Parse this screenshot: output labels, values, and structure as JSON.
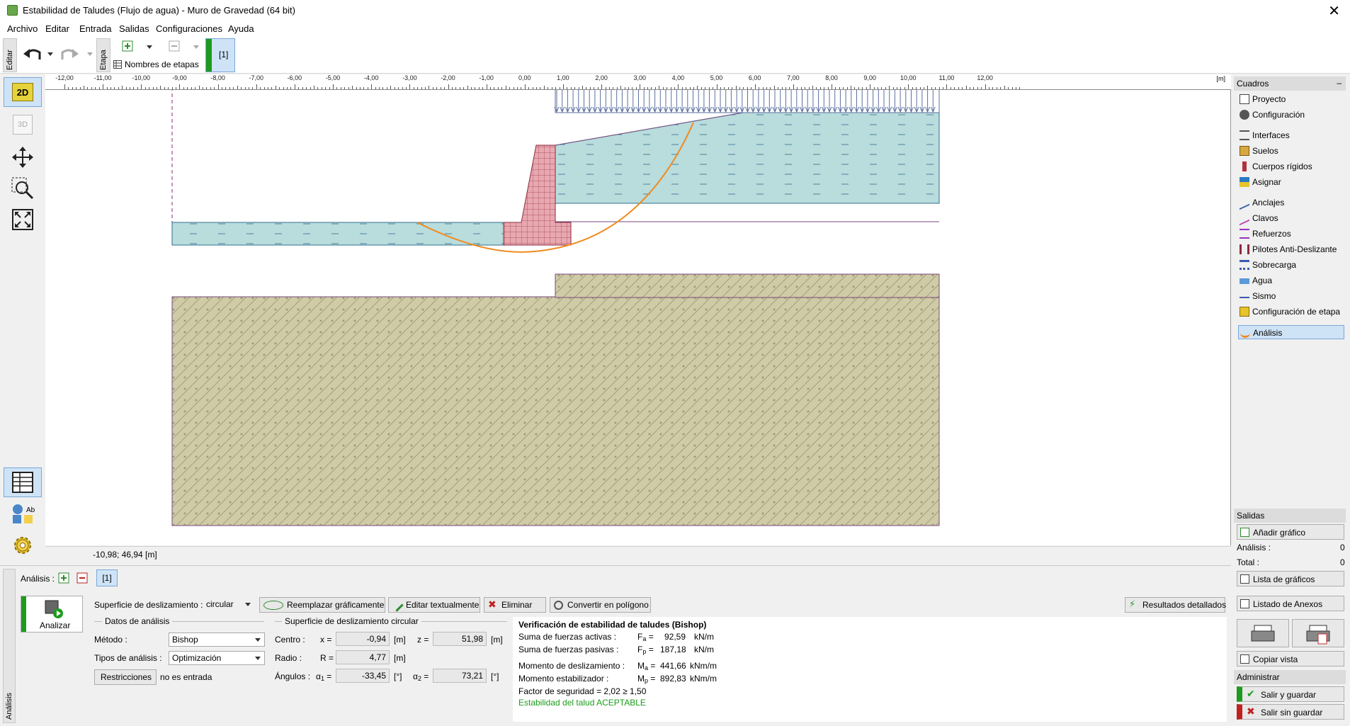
{
  "window": {
    "title": "Estabilidad de Taludes (Flujo de agua) - Muro de Gravedad (64 bit)",
    "close": "✕"
  },
  "menu": [
    "Archivo",
    "Editar",
    "Entrada",
    "Salidas",
    "Configuraciones",
    "Ayuda"
  ],
  "toolbar": {
    "edit_tab": "Editar",
    "stage_tab": "Etapa",
    "stage_names_label": "Nombres de etapas",
    "stage_button": "[1]"
  },
  "ruler": {
    "unit": "[m]",
    "ticks": [
      "-12,00",
      "-11,00",
      "-10,00",
      "-9,00",
      "-8,00",
      "-7,00",
      "-6,00",
      "-5,00",
      "-4,00",
      "-3,00",
      "-2,00",
      "-1,00",
      "0,00",
      "1,00",
      "2,00",
      "3,00",
      "4,00",
      "5,00",
      "6,00",
      "7,00",
      "8,00",
      "9,00",
      "10,00",
      "11,00",
      "12,00"
    ]
  },
  "leftpanel": {
    "view2d": "2D",
    "view3d": "3D",
    "ab_label": "Ab"
  },
  "status": {
    "coordinates": "-10,98; 46,94 [m]"
  },
  "right_panel": {
    "cuadros_title": "Cuadros",
    "collapse": "–",
    "items": [
      "Proyecto",
      "Configuración",
      "Interfaces",
      "Suelos",
      "Cuerpos rígidos",
      "Asignar",
      "Anclajes",
      "Clavos",
      "Refuerzos",
      "Pilotes Anti-Deslizante",
      "Sobrecarga",
      "Agua",
      "Sismo",
      "Configuración de etapa",
      "Análisis"
    ],
    "salidas_title": "Salidas",
    "add_chart": "Añadir gráfico",
    "analysis_label": "Análisis :",
    "analysis_count": "0",
    "total_label": "Total :",
    "total_count": "0",
    "chart_list": "Lista de gráficos",
    "annex_list": "Listado de Anexos",
    "copy_view": "Copiar vista",
    "admin_title": "Administrar",
    "save_exit": "Salir y guardar",
    "exit_nosave": "Salir sin guardar"
  },
  "bottom": {
    "side_tab": "Análisis",
    "analysis_label": "Análisis :",
    "analysis_button": "[1]",
    "analyze_label": "Analizar",
    "slip_surface_label": "Superficie de deslizamiento :",
    "slip_surface_value": "circular",
    "replace_graphic": "Reemplazar gráficamente",
    "edit_text": "Editar textualmente",
    "delete": "Eliminar",
    "convert_polygon": "Convertir en polígono",
    "detailed_results": "Resultados detallados",
    "analysis_data_title": "Datos de análisis",
    "method_label": "Método :",
    "method_value": "Bishop",
    "analysis_type_label": "Tipos de análisis :",
    "analysis_type_value": "Optimización",
    "restrictions_button": "Restricciones",
    "restrictions_value": "no es entrada",
    "circle_title": "Superficie de deslizamiento circular",
    "center_label": "Centro :",
    "x_label": "x =",
    "x_value": "-0,94",
    "x_unit": "[m]",
    "z_label": "z =",
    "z_value": "51,98",
    "z_unit": "[m]",
    "radius_label": "Radio :",
    "r_label": "R =",
    "r_value": "4,77",
    "r_unit": "[m]",
    "angles_label": "Ángulos :",
    "a1_label": "α",
    "a1_sub": "1",
    "a1_eq": "=",
    "a1_value": "-33,45",
    "a1_unit": "[°]",
    "a2_label": "α",
    "a2_sub": "2",
    "a2_eq": "=",
    "a2_value": "73,21",
    "a2_unit": "[°]"
  },
  "results": {
    "title": "Verificación de estabilidad de taludes (Bishop)",
    "active_label": "Suma de fuerzas activas :",
    "active_symbol": "F",
    "active_sub": "a",
    "active_value": "92,59",
    "active_unit": "kN/m",
    "passive_label": "Suma de fuerzas pasivas :",
    "passive_symbol": "F",
    "passive_sub": "p",
    "passive_value": "187,18",
    "passive_unit": "kN/m",
    "slide_moment_label": "Momento de deslizamiento :",
    "slide_symbol": "M",
    "slide_sub": "a",
    "slide_value": "441,66",
    "slide_unit": "kNm/m",
    "stab_moment_label": "Momento estabilizador :",
    "stab_symbol": "M",
    "stab_sub": "p",
    "stab_value": "892,83",
    "stab_unit": "kNm/m",
    "fs_line": "Factor de seguridad = 2,02 ≥ 1,50",
    "verdict": "Estabilidad del talud ACEPTABLE",
    "verdict_color": "#1a9c1a"
  },
  "colors": {
    "water": "#b9dcdc",
    "soil": "#cfcba6",
    "wall": "#e8a8b0",
    "slip_curve": "#f08a1e",
    "load": "#5b6f9e"
  }
}
